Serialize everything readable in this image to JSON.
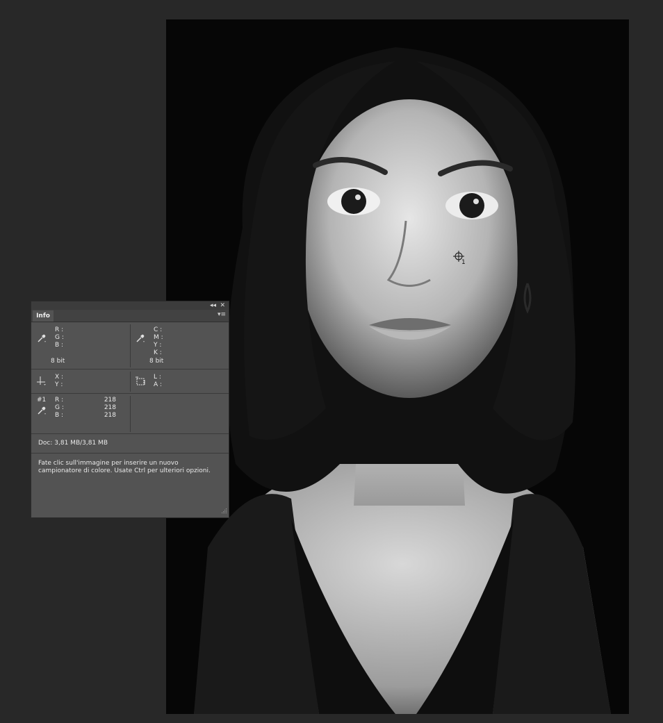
{
  "panel": {
    "tab_label": "Info",
    "collapse_glyph": "◂◂",
    "close_glyph": "✕",
    "menu_glyph": "▾≡",
    "rgb_block": {
      "r_label": "R :",
      "g_label": "G :",
      "b_label": "B :",
      "bit_depth": "8 bit",
      "icon": "eyedropper-icon"
    },
    "cmyk_block": {
      "c_label": "C :",
      "m_label": "M :",
      "y_label": "Y :",
      "k_label": "K :",
      "bit_depth": "8 bit",
      "icon": "eyedropper-icon"
    },
    "position_block": {
      "x_label": "X :",
      "y_label": "Y :",
      "icon": "crosshair-icon"
    },
    "size_block": {
      "w_label": "L :",
      "h_label": "A :",
      "icon": "selection-size-icon"
    },
    "sampler1": {
      "id": "#1",
      "r_label": "R :",
      "g_label": "G :",
      "b_label": "B :",
      "r_value": "218",
      "g_value": "218",
      "b_value": "218",
      "icon": "color-sampler-icon"
    },
    "doc_size": "Doc: 3,81 MB/3,81 MB",
    "hint_line1": "Fate clic sull'immagine per inserire un nuovo",
    "hint_line2": "campionatore di colore. Usate Ctrl per ulteriori opzioni."
  },
  "canvas": {
    "sampler_marker_label": "1",
    "photo": "black-and-white-portrait"
  },
  "colors": {
    "workspace_bg": "#282828",
    "panel_bg": "#535353",
    "panel_header": "#3c3c3c"
  }
}
